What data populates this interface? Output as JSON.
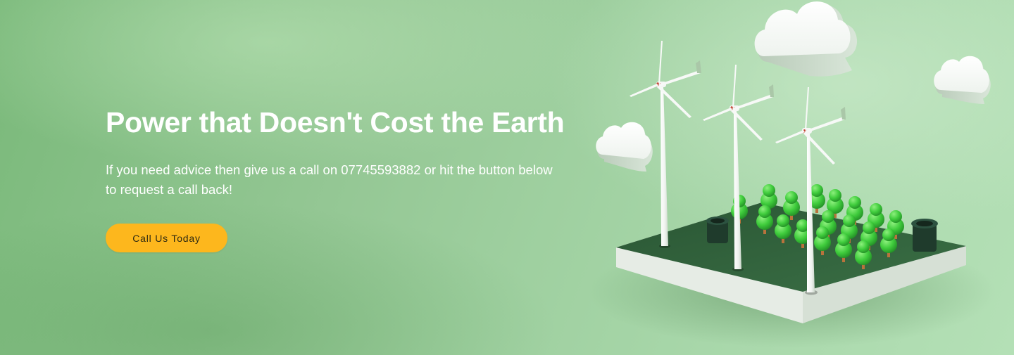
{
  "hero": {
    "headline": "Power that Doesn't Cost the Earth",
    "subtext": "If you need advice then give us a call on 07745593882 or hit the button below to request a call back!",
    "cta_label": "Call Us Today"
  },
  "illustration": {
    "icon": "wind-farm-illustration",
    "elements": [
      "wind-turbine",
      "wind-turbine",
      "wind-turbine",
      "tree-grove",
      "cloud",
      "cloud",
      "cloud",
      "planter",
      "planter"
    ]
  },
  "colors": {
    "background_start": "#7ab97a",
    "background_end": "#b4e0b6",
    "cta_background": "#fdb71d",
    "text": "#ffffff",
    "platform": "#2f5e3b"
  }
}
